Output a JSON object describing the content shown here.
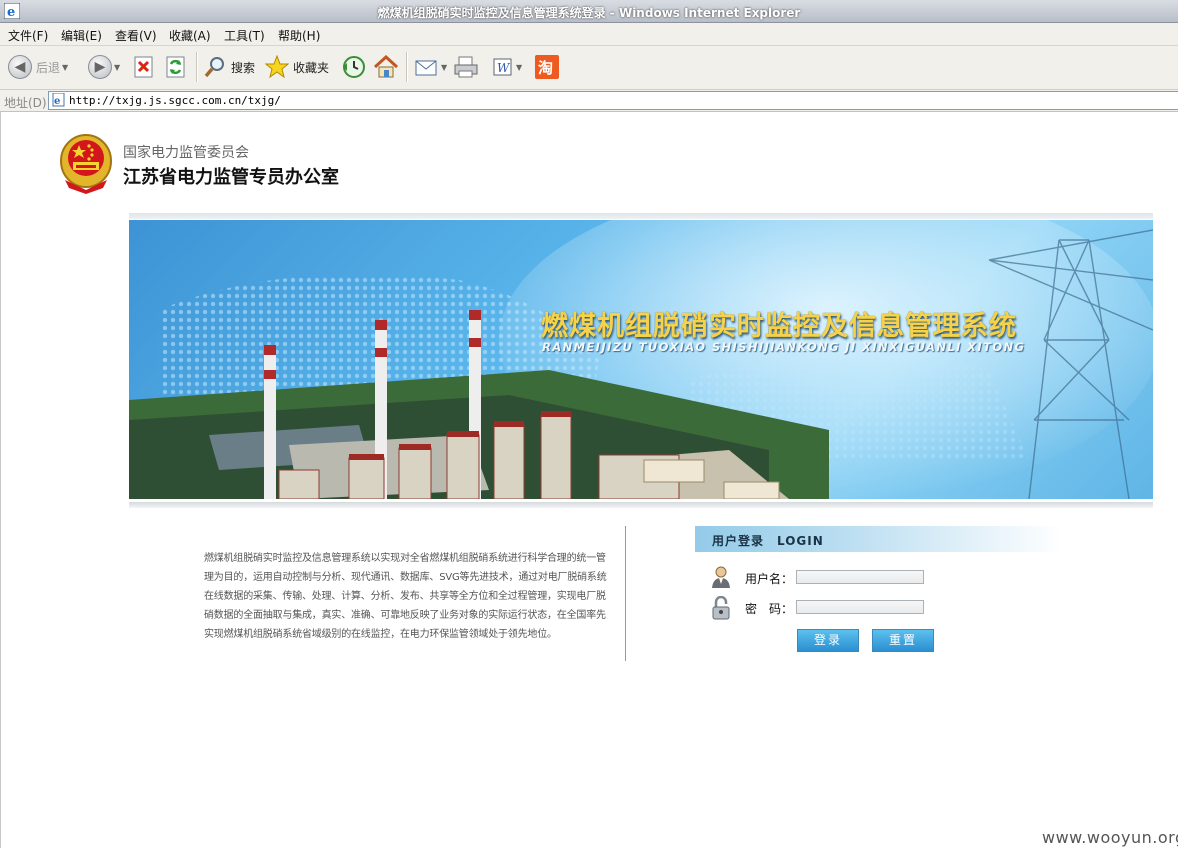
{
  "window": {
    "title": "燃煤机组脱硝实时监控及信息管理系统登录 - Windows Internet Explorer"
  },
  "menu": [
    "文件(F)",
    "编辑(E)",
    "查看(V)",
    "收藏(A)",
    "工具(T)",
    "帮助(H)"
  ],
  "toolbar": {
    "back_label": "后退",
    "search_label": "搜索",
    "favorites_label": "收藏夹",
    "icons": [
      "back-icon",
      "forward-icon",
      "stop-icon",
      "refresh-icon",
      "search-icon",
      "favorites-star-icon",
      "history-icon",
      "home-icon",
      "mail-icon",
      "print-icon",
      "edit-icon",
      "taobao-icon"
    ]
  },
  "address": {
    "label": "地址(D)",
    "url": "http://txjg.js.sgcc.com.cn/txjg/"
  },
  "header": {
    "org_top": "国家电力监管委员会",
    "org_main": "江苏省电力监管专员办公室"
  },
  "banner": {
    "title": "燃煤机组脱硝实时监控及信息管理系统",
    "subtitle": "RANMEIJIZU TUOXIAO SHISHIJIANKONG JI XINXIGUANLI XITONG"
  },
  "description": "燃煤机组脱硝实时监控及信息管理系统以实现对全省燃煤机组脱硝系统进行科学合理的统一管理为目的，运用自动控制与分析、现代通讯、数据库、SVG等先进技术，通过对电厂脱硝系统在线数据的采集、传输、处理、计算、分析、发布、共享等全方位和全过程管理，实现电厂脱硝数据的全面抽取与集成，真实、准确、可靠地反映了业务对象的实际运行状态，在全国率先实现燃煤机组脱硝系统省域级别的在线监控，在电力环保监管领域处于领先地位。",
  "login": {
    "heading": "用户登录　LOGIN",
    "username_label": "用户名：",
    "password_label": "密　码：",
    "username_value": "",
    "password_value": "",
    "login_button": "登录",
    "reset_button": "重置"
  },
  "watermark": "www.wooyun.org"
}
